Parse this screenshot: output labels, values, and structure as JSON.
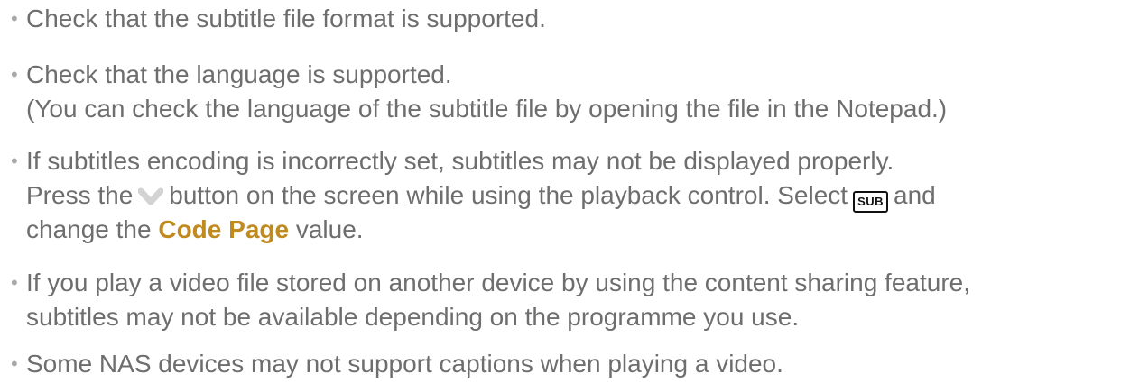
{
  "bullet_glyph": "•",
  "items": [
    {
      "line1": "Check that the subtitle file format is supported."
    },
    {
      "line1": "Check that the language is supported.",
      "line2": "(You can check the language of the subtitle file by opening the file in the Notepad.)"
    },
    {
      "line1": "If subtitles encoding is incorrectly set, subtitles may not be displayed properly.",
      "line2_before_icon": "Press the",
      "line2_after_icon": "button on the screen while using the playback control. Select",
      "sub_icon_label": "SUB",
      "line2_end": "and",
      "line3_before": "change the",
      "line3_highlight": "Code Page",
      "line3_after": "value."
    },
    {
      "line1": "If you play a video file stored on another device by using the content sharing feature,",
      "line2": "subtitles may not be available depending on the programme you use."
    },
    {
      "line1": "Some NAS devices may not support captions when playing a video."
    }
  ],
  "colors": {
    "text": "#6e6e6e",
    "highlight": "#c08a1e",
    "bullet": "#a8a8a8",
    "chevron": "#d0d0d0"
  },
  "icons": {
    "chevron": "chevron-down-icon",
    "subtitle": "sub-icon"
  }
}
